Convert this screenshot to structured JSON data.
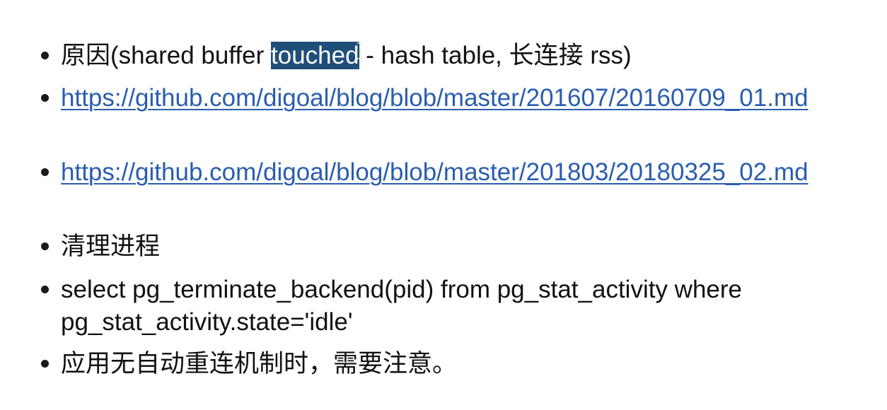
{
  "bullets": [
    {
      "before": "原因(shared buffer ",
      "selected": "touched",
      "after": " - hash table, 长连接 rss)"
    },
    {
      "link": "https://github.com/digoal/blog/blob/master/201607/20160709_01.md"
    },
    {
      "link": "https://github.com/digoal/blog/blob/master/201803/20180325_02.md"
    },
    {
      "text": "清理进程"
    },
    {
      "line1": "select pg_terminate_backend(pid) from pg_stat_activity where",
      "line2": "pg_stat_activity.state='idle'"
    },
    {
      "text": "应用无自动重连机制时，需要注意。"
    }
  ],
  "theme": {
    "link_color": "#2a5db0",
    "selection_color": "#1f4e79",
    "text_color": "#111111"
  },
  "icons": {
    "cursor": "text-cursor-ibeam-icon",
    "bullet": "bullet-dot-icon"
  }
}
